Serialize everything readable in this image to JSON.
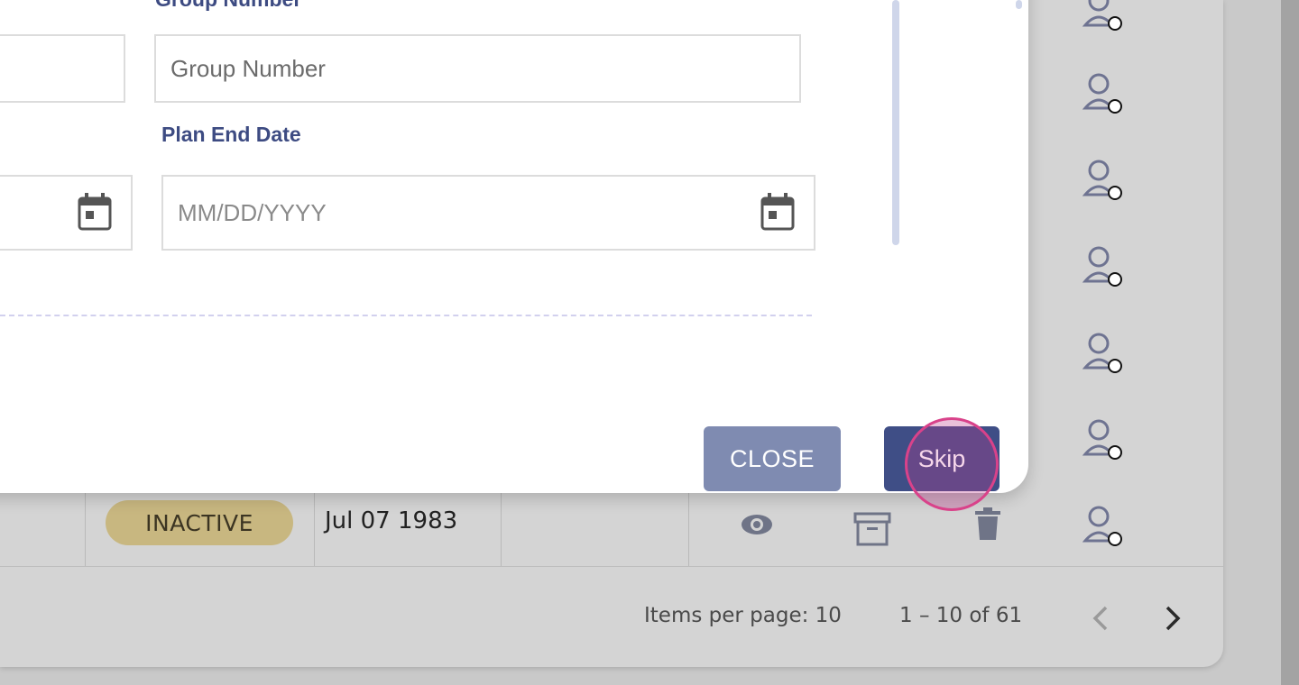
{
  "modal": {
    "group_number_label": "Group Number",
    "group_number_placeholder": "Group Number",
    "plan_end_date_label": "Plan End Date",
    "plan_end_date_placeholder": "MM/DD/YYYY",
    "close_button": "CLOSE",
    "skip_button": "Skip"
  },
  "table": {
    "row": {
      "status": "INACTIVE",
      "date": "Jul 07 1983"
    }
  },
  "pagination": {
    "items_per_page": "Items per page: 10",
    "range": "1 – 10 of 61"
  },
  "icons": {
    "view": "eye-icon",
    "archive": "archive-icon",
    "delete": "trash-icon",
    "calendar": "calendar-icon",
    "person": "person-clock-icon",
    "prev": "chevron-left-icon",
    "next": "chevron-right-icon"
  },
  "colors": {
    "label": "#3d4b82",
    "close_button": "#7f8bb1",
    "skip_button": "#3f4e86",
    "status_badge": "#c8b780",
    "click_indicator": "#d9428a"
  }
}
